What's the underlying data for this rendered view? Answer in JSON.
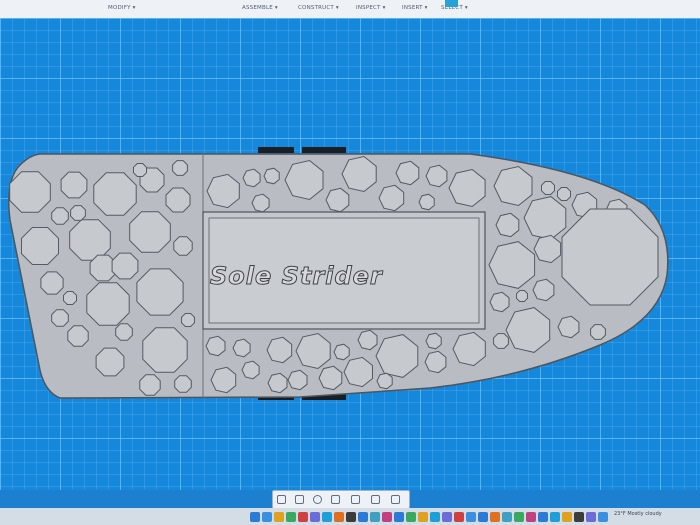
{
  "toolbar": {
    "menus": [
      "MODIFY ▾",
      "ASSEMBLE ▾",
      "CONSTRUCT ▾",
      "INSPECT ▾",
      "INSERT ▾",
      "SELECT ▾"
    ]
  },
  "model": {
    "label": "Sole Strider"
  },
  "navbar": {
    "icons": [
      "orbit-icon",
      "pan-icon",
      "zoom-icon",
      "fit-icon",
      "display-settings-icon",
      "grid-settings-icon",
      "viewports-icon"
    ]
  },
  "taskbar": {
    "weather": "23°F  Mostly cloudy"
  },
  "colors": {
    "grid_background": "#1688db",
    "sole": "#b9bdc3",
    "shape_fill": "#c6c9ce",
    "shape_stroke": "#555b63"
  }
}
